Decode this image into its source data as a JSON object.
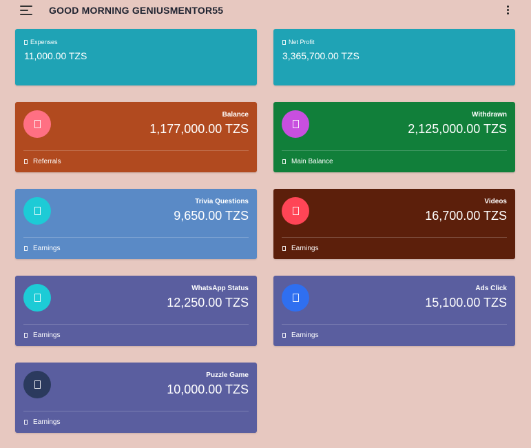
{
  "header": {
    "greeting": "GOOD MORNING GENIUSMENTOR55"
  },
  "icons": {
    "menu": "hamburger-menu-icon",
    "more": "kebab-more-icon"
  },
  "summary": [
    {
      "label": "Expenses",
      "value": "11,000.00 TZS",
      "color": "#1fa3b5"
    },
    {
      "label": "Net Profit",
      "value": "3,365,700.00 TZS",
      "color": "#1fa3b5"
    }
  ],
  "stats": [
    {
      "title": "Balance",
      "amount": "1,177,000.00 TZS",
      "footer": "Referrals",
      "card_color": "#b14a1f",
      "icon_color": "#ff7083"
    },
    {
      "title": "Withdrawn",
      "amount": "2,125,000.00 TZS",
      "footer": "Main Balance",
      "card_color": "#117f3a",
      "icon_color": "#c84fdf"
    },
    {
      "title": "Trivia Questions",
      "amount": "9,650.00 TZS",
      "footer": "Earnings",
      "card_color": "#5a8ac6",
      "icon_color": "#1dcbd6"
    },
    {
      "title": "Videos",
      "amount": "16,700.00 TZS",
      "footer": "Earnings",
      "card_color": "#5c1f0b",
      "icon_color": "#ff4556"
    },
    {
      "title": "WhatsApp Status",
      "amount": "12,250.00 TZS",
      "footer": "Earnings",
      "card_color": "#5a5e9f",
      "icon_color": "#1dcbd6"
    },
    {
      "title": "Ads Click",
      "amount": "15,100.00 TZS",
      "footer": "Earnings",
      "card_color": "#5a5e9f",
      "icon_color": "#2f6ff0"
    },
    {
      "title": "Puzzle Game",
      "amount": "10,000.00 TZS",
      "footer": "Earnings",
      "card_color": "#5a5e9f",
      "icon_color": "#2b3a5e"
    }
  ]
}
